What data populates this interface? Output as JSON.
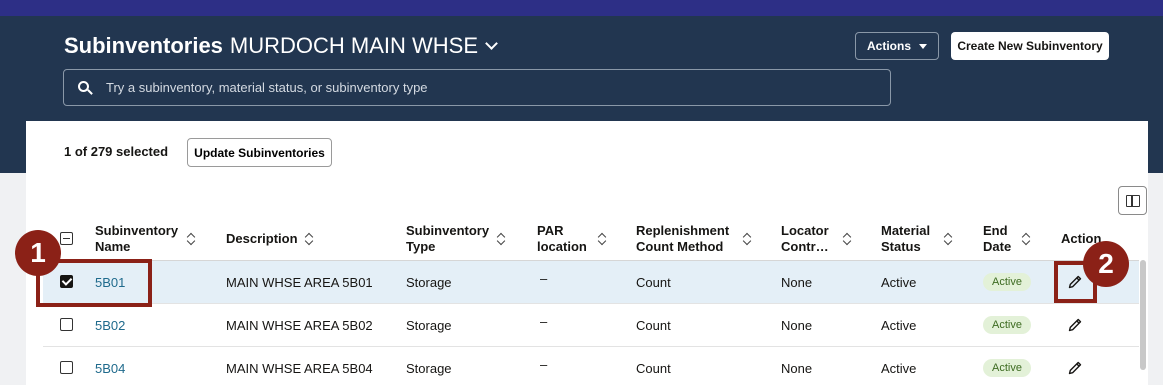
{
  "header": {
    "title_strong": "Subinventories",
    "title_org": "MURDOCH MAIN WHSE",
    "actions_label": "Actions",
    "create_label": "Create New Subinventory",
    "search_placeholder": "Try a subinventory, material status, or subinventory type"
  },
  "toolbar": {
    "selection_count": "1 of 279 selected",
    "update_label": "Update Subinventories"
  },
  "table": {
    "columns": {
      "name_1": "Subinventory",
      "name_2": "Name",
      "description": "Description",
      "type_1": "Subinventory",
      "type_2": "Type",
      "par_1": "PAR",
      "par_2": "location",
      "repl_1": "Replenishment",
      "repl_2": "Count Method",
      "locator_1": "Locator",
      "locator_2": "Contr…",
      "status_1": "Material",
      "status_2": "Status",
      "end_1": "End",
      "end_2": "Date",
      "action": "Action"
    },
    "rows": [
      {
        "name": "5B01",
        "description": "MAIN WHSE AREA 5B01",
        "type": "Storage",
        "par": "–",
        "count_method": "Count",
        "locator": "None",
        "status": "Active",
        "end_date": "Active",
        "selected": true
      },
      {
        "name": "5B02",
        "description": "MAIN WHSE AREA 5B02",
        "type": "Storage",
        "par": "–",
        "count_method": "Count",
        "locator": "None",
        "status": "Active",
        "end_date": "Active",
        "selected": false
      },
      {
        "name": "5B04",
        "description": "MAIN WHSE AREA 5B04",
        "type": "Storage",
        "par": "–",
        "count_method": "Count",
        "locator": "None",
        "status": "Active",
        "end_date": "Active",
        "selected": false
      }
    ]
  },
  "callouts": {
    "first": "1",
    "second": "2"
  },
  "colors": {
    "header_bg": "#223650",
    "topbar": "#2d2f86",
    "link": "#1f6a8c",
    "callout": "#8b2117",
    "badge_bg": "#e3f1d8"
  },
  "icons": {
    "title_chevron": "chevron-down-icon",
    "search": "search-icon",
    "columns": "column-toggle-icon",
    "edit": "pencil-icon",
    "sort": "sort-icon"
  }
}
